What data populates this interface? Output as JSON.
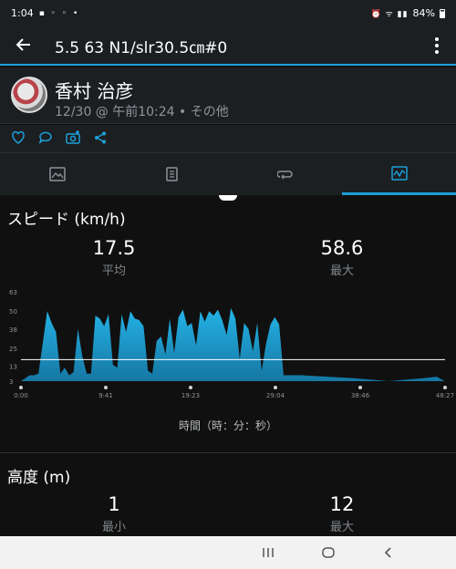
{
  "status_bar": {
    "time": "1:04",
    "battery": "84%"
  },
  "app_bar": {
    "title": "5.5 63 N1/slr30.5㎝#0",
    "back_icon": "arrow-left-icon",
    "menu_icon": "more-vert-icon"
  },
  "profile": {
    "name": "香村 治彦",
    "meta": "12/30 @ 午前10:24 • その他"
  },
  "actions": [
    "heart-icon",
    "comment-icon",
    "camera-add-icon",
    "share-icon"
  ],
  "tabs": [
    {
      "icon": "map-icon",
      "active": false
    },
    {
      "icon": "summary-icon",
      "active": false
    },
    {
      "icon": "laps-icon",
      "active": false
    },
    {
      "icon": "graph-icon",
      "active": true
    }
  ],
  "speed": {
    "title": "スピード (km/h)",
    "avg_value": "17.5",
    "avg_label": "平均",
    "max_value": "58.6",
    "max_label": "最大",
    "x_axis_title": "時間（時：分：秒）"
  },
  "altitude": {
    "title": "高度 (m)",
    "min_value": "1",
    "min_label": "最小",
    "max_value": "12",
    "max_label": "最大"
  },
  "colors": {
    "accent": "#1ba1d9",
    "background": "#101010",
    "panel": "#1c1f22"
  },
  "chart_data": {
    "type": "area",
    "xlabel": "時間（時：分：秒）",
    "ylabel": "",
    "x_ticks": [
      "0:00",
      "9:41",
      "19:23",
      "29:04",
      "38:46",
      "48:27"
    ],
    "y_ticks": [
      "3",
      "13",
      "25",
      "38",
      "50",
      "63"
    ],
    "ylim": [
      3,
      63
    ],
    "xlim_minutes": [
      0,
      48.45
    ],
    "average_line": 17.5,
    "series": [
      {
        "values_minutes": [
          0,
          1,
          1.5,
          2,
          3,
          3.5,
          4,
          4.5,
          5,
          5.5,
          6,
          6.5,
          7,
          7.5,
          8,
          8.5,
          9,
          9.5,
          10,
          10.5,
          11,
          11.5,
          12,
          12.5,
          13,
          13.5,
          14,
          14.5,
          15,
          15.5,
          16,
          16.5,
          17,
          17.5,
          18,
          18.5,
          19,
          19.5,
          20,
          20.5,
          21,
          21.5,
          22,
          22.5,
          23,
          23.5,
          24,
          24.5,
          25,
          25.5,
          26,
          26.5,
          27,
          27.5,
          28,
          28.5,
          29,
          29.5,
          30,
          32,
          35,
          38,
          40,
          42,
          44,
          46,
          47.5,
          48.4
        ],
        "speeds": [
          3,
          7,
          7,
          8,
          50,
          42,
          36,
          8,
          12,
          7,
          9,
          38,
          20,
          8,
          8,
          47,
          45,
          40,
          48,
          14,
          12,
          48,
          36,
          50,
          45,
          44,
          40,
          10,
          8,
          30,
          33,
          21,
          45,
          22,
          46,
          51,
          40,
          42,
          27,
          50,
          43,
          50,
          47,
          51,
          44,
          34,
          52,
          45,
          18,
          42,
          38,
          23,
          42,
          10,
          28,
          41,
          46,
          41,
          7,
          7,
          6,
          5,
          4,
          3,
          4,
          5,
          6,
          3
        ]
      }
    ]
  }
}
